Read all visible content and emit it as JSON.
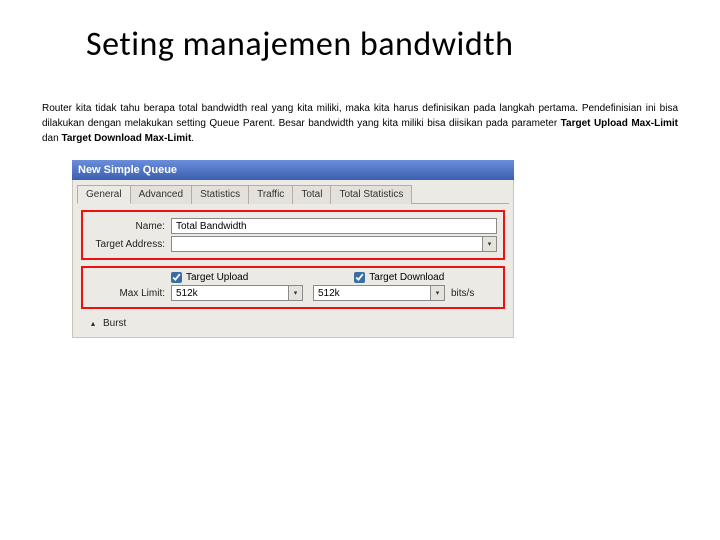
{
  "title": "Seting manajemen bandwidth",
  "paragraph": {
    "text_before": "Router kita tidak tahu berapa total bandwidth real yang kita miliki, maka kita harus definisikan pada langkah pertama. Pendefinisian ini bisa dilakukan dengan melakukan setting Queue Parent. Besar bandwidth yang kita miliki bisa diisikan pada parameter ",
    "bold1": "Target Upload Max-Limit",
    "mid": " dan ",
    "bold2": "Target Download Max-Limit",
    "text_after": "."
  },
  "dialog": {
    "title": "New Simple Queue",
    "tabs": [
      "General",
      "Advanced",
      "Statistics",
      "Traffic",
      "Total",
      "Total Statistics"
    ],
    "active_tab": 0,
    "name_label": "Name:",
    "name_value": "Total Bandwidth",
    "target_label": "Target Address:",
    "target_value": "",
    "upload_checkbox_label": "Target Upload",
    "download_checkbox_label": "Target Download",
    "maxlimit_label": "Max Limit:",
    "upload_value": "512k",
    "download_value": "512k",
    "unit": "bits/s",
    "burst_label": "Burst"
  }
}
